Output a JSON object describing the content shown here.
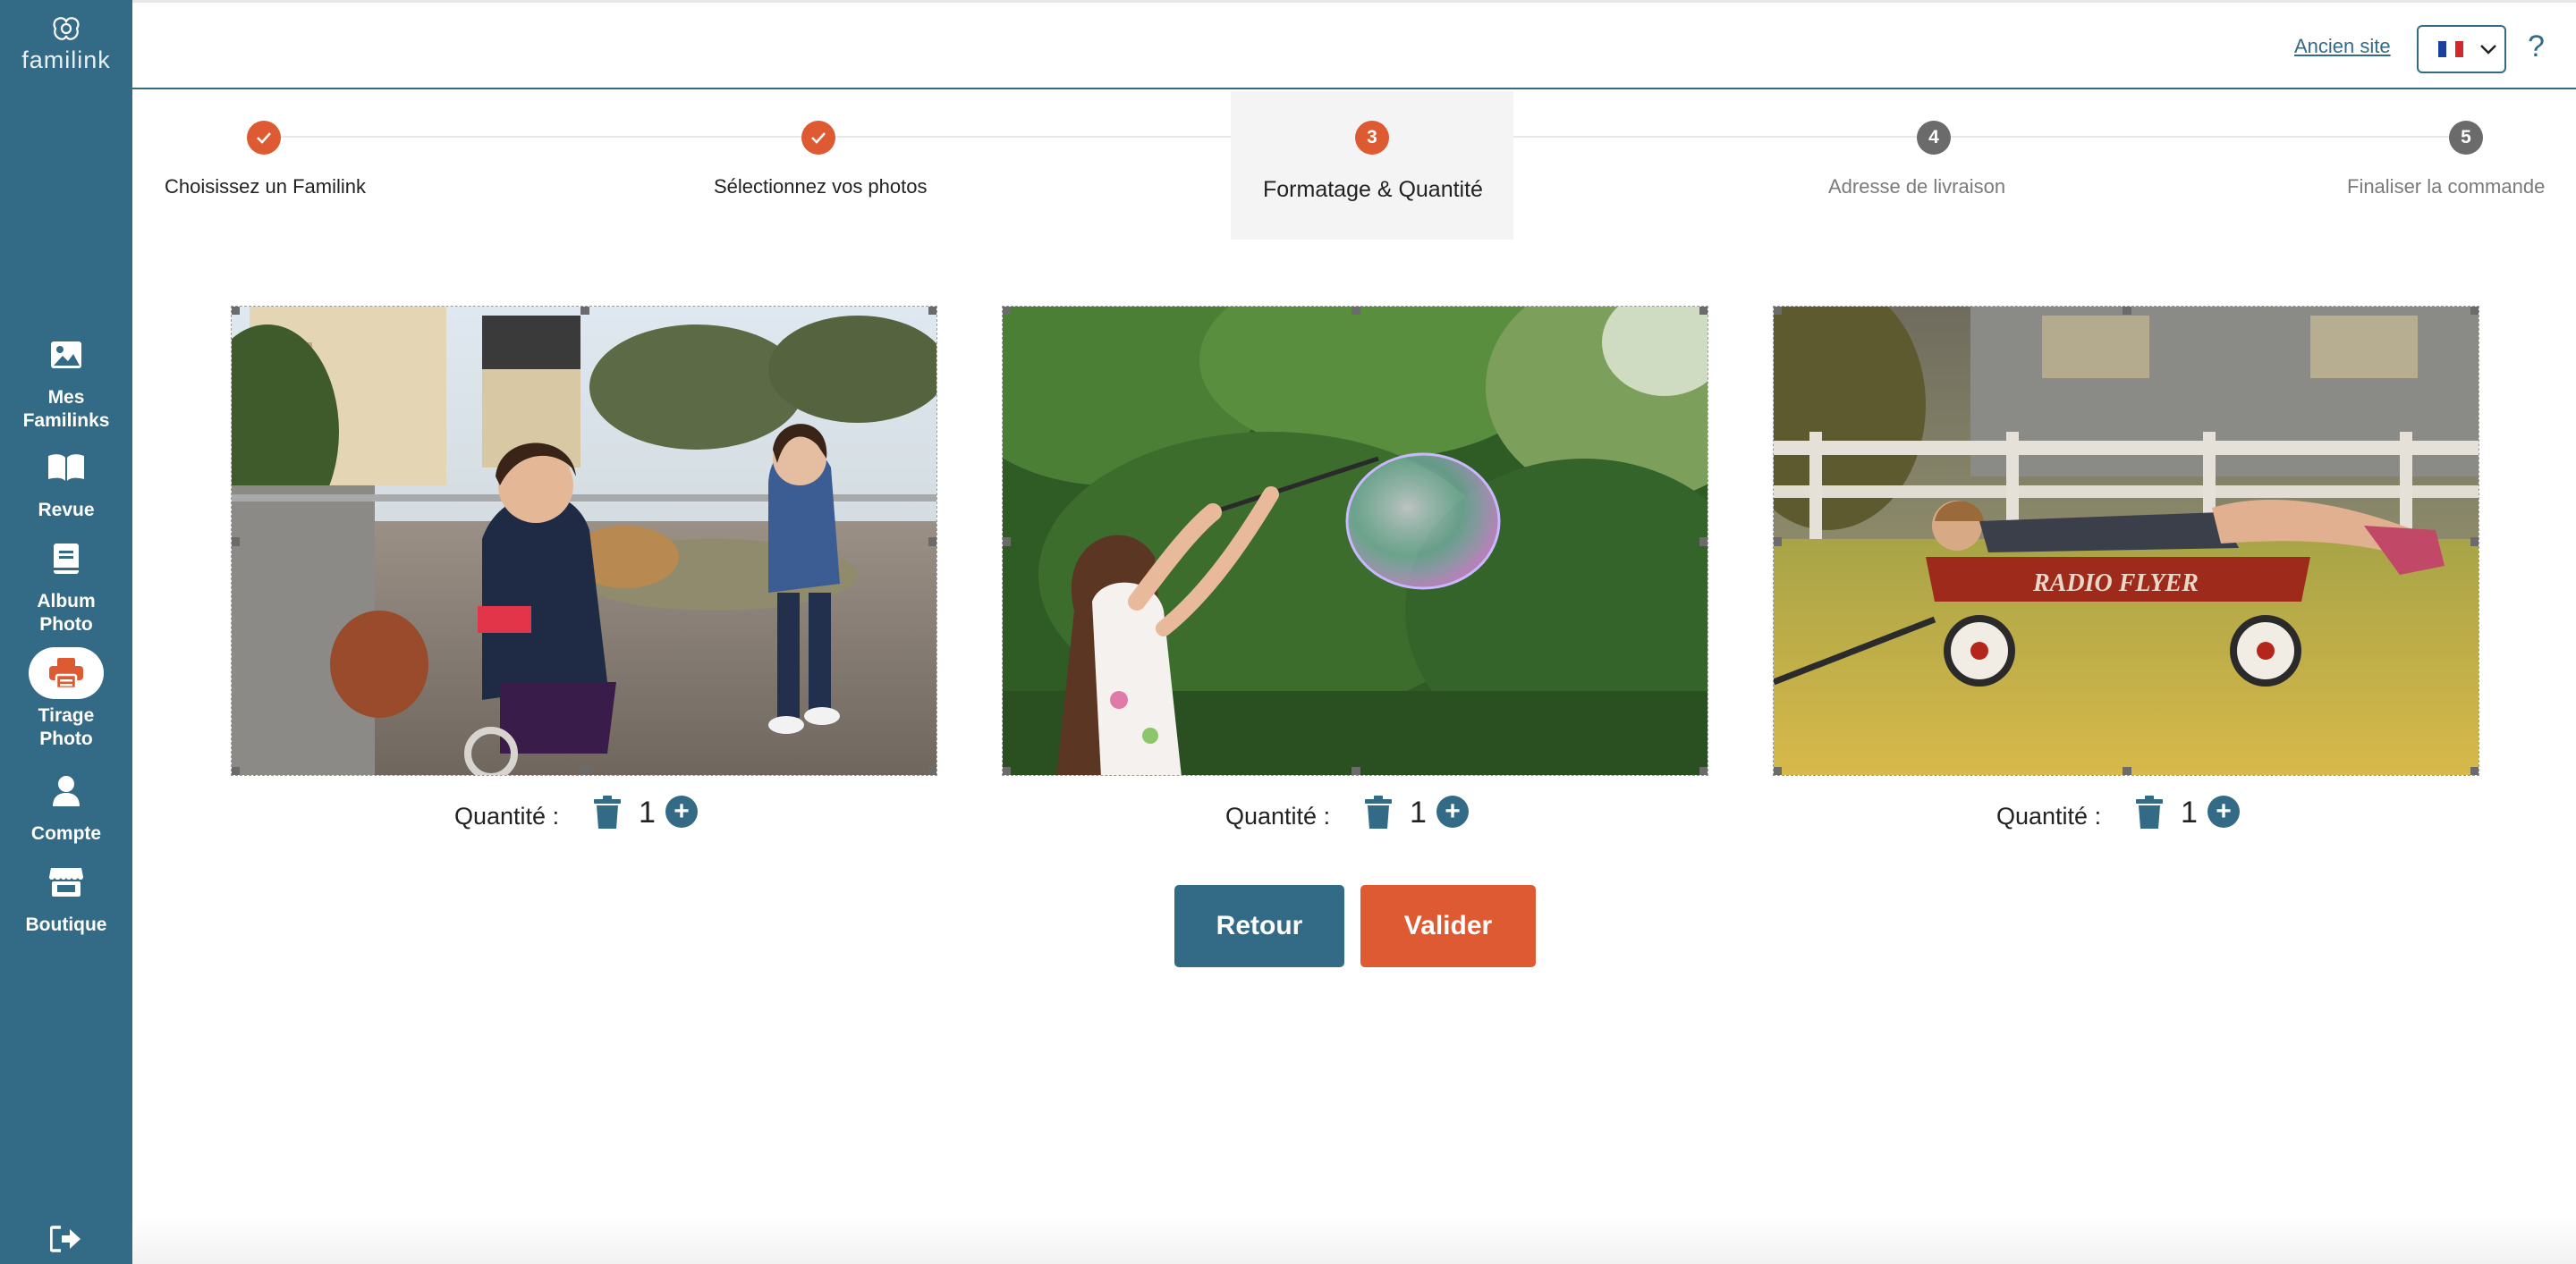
{
  "brand": {
    "name": "familink"
  },
  "sidebar": {
    "items": [
      {
        "label": "Mes\nFamilinks",
        "icon": "image-icon",
        "active": false
      },
      {
        "label": "Revue",
        "icon": "open-book-icon",
        "active": false
      },
      {
        "label": "Album\nPhoto",
        "icon": "album-icon",
        "active": false
      },
      {
        "label": "Tirage\nPhoto",
        "icon": "printer-icon",
        "active": true
      },
      {
        "label": "Compte",
        "icon": "user-icon",
        "active": false
      },
      {
        "label": "Boutique",
        "icon": "store-icon",
        "active": false
      }
    ],
    "logout_icon": "logout-icon"
  },
  "header": {
    "old_site_label": "Ancien site",
    "language_flag": "fr-flag-icon",
    "help_label": "?"
  },
  "stepper": {
    "steps": [
      {
        "number": "✓",
        "label": "Choisissez un Familink",
        "state": "done"
      },
      {
        "number": "✓",
        "label": "Sélectionnez vos photos",
        "state": "done"
      },
      {
        "number": "3",
        "label": "Formatage & Quantité",
        "state": "active"
      },
      {
        "number": "4",
        "label": "Adresse de livraison",
        "state": "future"
      },
      {
        "number": "5",
        "label": "Finaliser la commande",
        "state": "future"
      }
    ]
  },
  "photos": [
    {
      "quantity_label": "Quantité :",
      "quantity": "1"
    },
    {
      "quantity_label": "Quantité :",
      "quantity": "1"
    },
    {
      "quantity_label": "Quantité :",
      "quantity": "1"
    }
  ],
  "actions": {
    "back_label": "Retour",
    "validate_label": "Valider"
  },
  "colors": {
    "primary": "#336a86",
    "accent": "#dd5a33",
    "step_done": "#dd5a33",
    "step_future": "#6b6b6b"
  }
}
